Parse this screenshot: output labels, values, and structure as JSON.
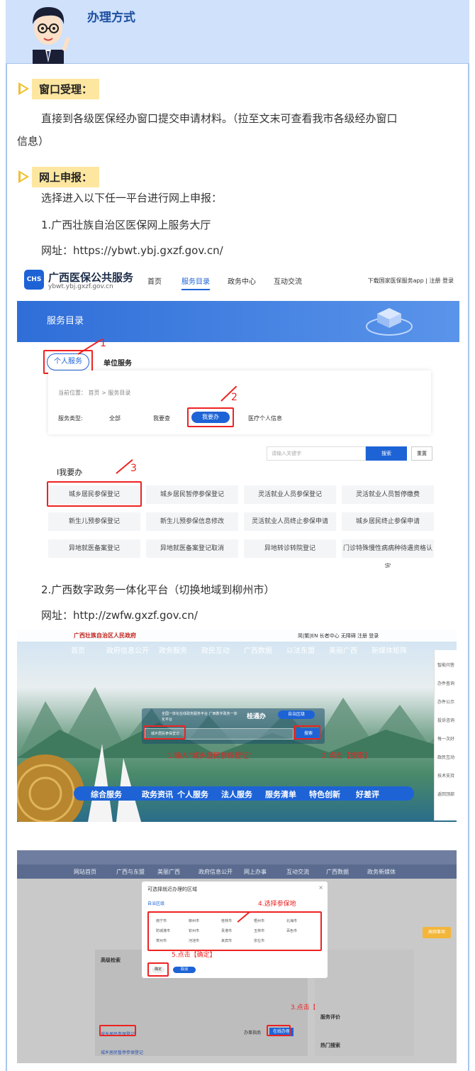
{
  "header": {
    "title": "办理方式"
  },
  "window": {
    "badge": "窗口受理：",
    "text_line1": "直接到各级医保经办窗口提交申请材料。（拉至文末可查看我市各级经办窗口",
    "text_line2": "信息）"
  },
  "online": {
    "badge": "网上申报：",
    "intro": "选择进入以下任一平台进行网上申报：",
    "p1_title": "1.广西壮族自治区医保网上服务大厅",
    "p1_url": "网址：https://ybwt.ybj.gxzf.gov.cn/",
    "p2_title": "2.广西数字政务一体化平台（切换地域到柳州市）",
    "p2_url": "网址：http://zwfw.gxzf.gov.cn/"
  },
  "shot1": {
    "logo": "CHS",
    "site_name": "广西医保公共服务",
    "site_url": "ybwt.ybj.gxzf.gov.cn",
    "nav": [
      "首页",
      "服务目录",
      "政务中心",
      "互动交流"
    ],
    "top_right": "下载国家医保服务app | 注册 登录",
    "banner_title": "服务目录",
    "tab_personal": "个人服务",
    "tab_unit": "单位服务",
    "breadcrumb": "当前位置： 首页 > 服务目录",
    "service_type_label": "服务类型:",
    "types": [
      "全部",
      "我要查",
      "我要办",
      "医疗个人信息"
    ],
    "search_placeholder": "请输入关键字",
    "search_btn": "搜索",
    "reset_btn": "重置",
    "section": "I我要办",
    "grid": [
      [
        "城乡居民参保登记",
        "城乡居民暂停参保登记",
        "灵活就业人员参保登记",
        "灵活就业人员暂停缴费"
      ],
      [
        "新生儿预参保登记",
        "新生儿预参保信息修改",
        "灵活就业人员终止参保申请",
        "城乡居民终止参保申请"
      ],
      [
        "异地就医备案登记",
        "异地就医备案登记取消",
        "异地转诊转院登记",
        "门诊特殊慢性病病种待遇资格认定"
      ]
    ],
    "marks": [
      "1",
      "2",
      "3"
    ]
  },
  "shot2": {
    "gov_title": "广西壮族自治区人民政府",
    "top_links": "简|繁|EN 长者中心 无障碍 注册 登录",
    "nav": [
      "首页",
      "政府信息公开",
      "政务服务",
      "政民互动",
      "广西数据",
      "以法东盟",
      "美丽广西",
      "新媒体矩阵"
    ],
    "platform_name": "全国一体化在线政务服务平台 广西数字政务一体化平台",
    "platform_brand": "桂通办",
    "region_btn": "自治区级",
    "search_value": "城乡居民参保登记",
    "search_btn": "搜索",
    "annotation1": "1.输入“城乡居民参保登记”",
    "annotation2": "2.点击【搜索】",
    "menu": [
      "综合服务",
      "政务资讯",
      "个人服务",
      "法人服务",
      "服务清单",
      "特色创新",
      "好差评"
    ],
    "sidebar": [
      "智能问答",
      "办件查询",
      "办件公示",
      "投诉咨询",
      "每一次好",
      "政民互动",
      "技术支持",
      "返回顶部"
    ]
  },
  "shot3": {
    "nav": [
      "网站首页",
      "广西与东盟",
      "美丽广西",
      "政府信息公开",
      "网上办事",
      "互动交流",
      "广西数据",
      "政务新媒体"
    ],
    "modal_title": "可选择就近办理的区域",
    "modal_tab": "自治区级",
    "cities": [
      "南宁市",
      "柳州市",
      "桂林市",
      "梧州市",
      "北海市",
      "防城港市",
      "钦州市",
      "贵港市",
      "玉林市",
      "百色市",
      "贺州市",
      "河池市",
      "来宾市",
      "崇左市"
    ],
    "modal_ok": "确定",
    "modal_cancel": "取消",
    "annotation4": "4.选择参保地",
    "annotation5": "5.点击【确定】",
    "annotation3": "3.点击【在线办理】",
    "search_label": "高级检索",
    "result": "城乡居民参保登记",
    "result2": "城乡居民暂停参保登记",
    "online_btn": "在线办理",
    "guide_btn": "办事指南",
    "side_rating": "服务评价",
    "side_hot": "热门搜索",
    "float_btn": "高频事项"
  }
}
